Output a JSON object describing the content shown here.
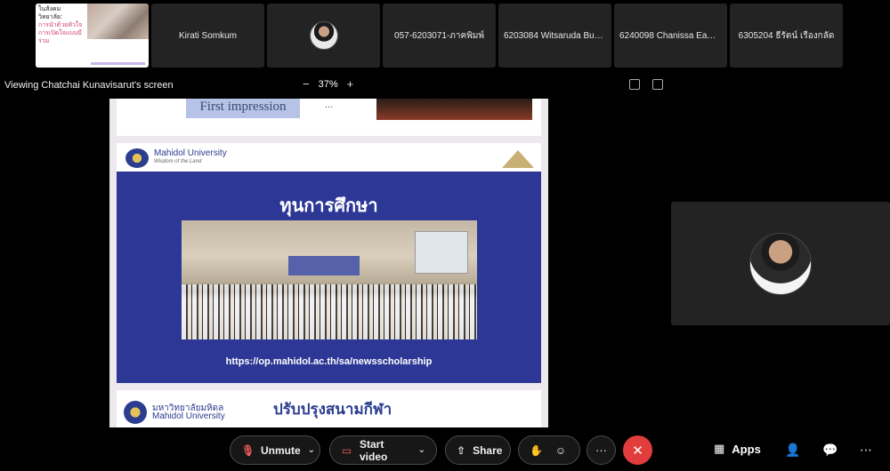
{
  "participants": [
    {
      "type": "screen-share",
      "title_lines": [
        "ในสังคม",
        "วิทยาลัย:",
        "การนำด้วยหัวใจ",
        "การเปิดใจแบบมี",
        "ร่วม"
      ]
    },
    {
      "type": "name",
      "name": "Kirati Somkum"
    },
    {
      "type": "avatar",
      "name": ""
    },
    {
      "type": "name",
      "name": "057-6203071-ภาคพิมพ์"
    },
    {
      "type": "name",
      "name": "6203084 Witsaruda Bua..."
    },
    {
      "type": "name",
      "name": "6240098 Chanissa Eams..."
    },
    {
      "type": "name",
      "name": "6305204 ธีรัตน์ เรืองกลัด"
    }
  ],
  "viewbar": {
    "viewing_text": "Viewing Chatchai Kunavisarut's screen",
    "zoom_minus": "−",
    "zoom_level": "37%",
    "zoom_plus": "+"
  },
  "shared_screen": {
    "slide1": {
      "left_text": "First impression",
      "dots": "..."
    },
    "slide2": {
      "university": "Mahidol University",
      "motto": "Wisdom of the Land",
      "title": "ทุนการศึกษา",
      "url": "https://op.mahidol.ac.th/sa/newsscholarship"
    },
    "slide3": {
      "university_th": "มหาวิทยาลัยมหิดล",
      "university_en": "Mahidol University",
      "title": "ปรับปรุงสนามกีฬา"
    }
  },
  "toolbar": {
    "unmute_label": "Unmute",
    "start_video_label": "Start video",
    "share_label": "Share",
    "more_label": "···",
    "end_label": "✕",
    "apps_label": "Apps"
  },
  "colors": {
    "background": "#000000",
    "tile": "#232323",
    "slide_blue": "#2d3896",
    "end_red": "#e23d3d",
    "muted_red": "#f25c5c"
  }
}
